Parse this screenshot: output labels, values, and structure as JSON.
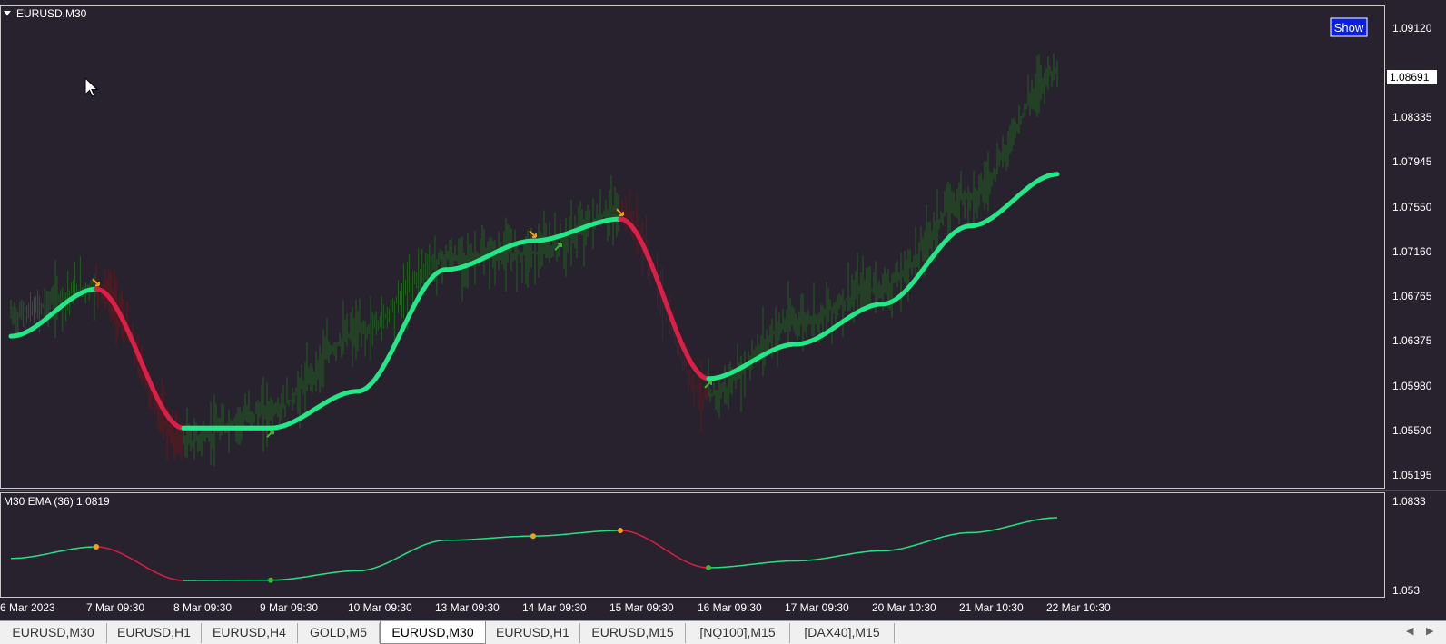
{
  "symbol_label": "EURUSD,M30",
  "show_button": "Show",
  "current_price": "1.08691",
  "price_axis_labels": [
    "1.09120",
    "1.08335",
    "1.07945",
    "1.07550",
    "1.07160",
    "1.06765",
    "1.06375",
    "1.05980",
    "1.05590",
    "1.05195"
  ],
  "indicator": {
    "label": "M30 EMA (36) 1.0819",
    "axis_labels": [
      "1.0833",
      "1.053"
    ]
  },
  "time_axis_labels": [
    "6 Mar 2023",
    "7 Mar 09:30",
    "8 Mar 09:30",
    "9 Mar 09:30",
    "10 Mar 09:30",
    "13 Mar 09:30",
    "14 Mar 09:30",
    "15 Mar 09:30",
    "16 Mar 09:30",
    "17 Mar 09:30",
    "20 Mar 10:30",
    "21 Mar 10:30",
    "22 Mar 10:30"
  ],
  "tabs": [
    {
      "label": "EURUSD,M30",
      "active": false
    },
    {
      "label": "EURUSD,H1",
      "active": false
    },
    {
      "label": "EURUSD,H4",
      "active": false
    },
    {
      "label": "GOLD,M5",
      "active": false
    },
    {
      "label": "EURUSD,M30",
      "active": true
    },
    {
      "label": "EURUSD,H1",
      "active": false
    },
    {
      "label": "EURUSD,M15",
      "active": false
    },
    {
      "label": "[NQ100],M15",
      "active": false
    },
    {
      "label": "[DAX40],M15",
      "active": false
    }
  ],
  "colors": {
    "background": "#28222f",
    "bullish": "#23e887",
    "bearish": "#dc1f47",
    "price_up": "#1f5e1f",
    "price_down": "#6b1414",
    "signal_up_arrow": "#3fb535",
    "signal_down_arrow": "#f0a020",
    "axis_text": "#ffffff",
    "show_button_bg": "#0a1ee6"
  },
  "chart_data": [
    {
      "type": "line",
      "title": "EURUSD,M30",
      "x": [
        "6 Mar 2023",
        "7 Mar 09:30",
        "8 Mar 09:30",
        "9 Mar 09:30",
        "10 Mar 09:30",
        "13 Mar 09:30",
        "14 Mar 09:30",
        "15 Mar 09:30",
        "16 Mar 09:30",
        "17 Mar 09:30",
        "20 Mar 10:30",
        "21 Mar 10:30",
        "22 Mar 10:30"
      ],
      "ylim": [
        1.0505,
        1.0925
      ],
      "series": [
        {
          "values": [
            1.0637,
            1.0678,
            1.0557,
            1.0557,
            1.0589,
            1.0695,
            1.072,
            1.0739,
            1.06,
            1.063,
            1.0665,
            1.0733,
            1.0778
          ]
        },
        {
          "values": [
            1.0655,
            1.068,
            1.0545,
            1.0572,
            1.064,
            1.0705,
            1.071,
            1.0745,
            1.0585,
            1.065,
            1.068,
            1.076,
            1.0869
          ]
        }
      ],
      "signals": [
        {
          "x": "7 Mar 09:30",
          "direction": "down"
        },
        {
          "x": "9 Mar 09:30",
          "direction": "up"
        },
        {
          "x": "14 Mar 09:30",
          "direction": "down"
        },
        {
          "x": "14 Mar 09:30",
          "direction": "up"
        },
        {
          "x": "15 Mar 09:30",
          "direction": "down"
        },
        {
          "x": "16 Mar 09:30",
          "direction": "up"
        }
      ]
    },
    {
      "type": "line",
      "title": "M30 EMA (36) 1.0819",
      "ylim": [
        1.05,
        1.087
      ],
      "series": [
        {
          "values": [
            1.0636,
            1.0677,
            1.0558,
            1.0559,
            1.0592,
            1.07,
            1.0715,
            1.0735,
            1.0603,
            1.0627,
            1.0663,
            1.0727,
            1.078
          ]
        }
      ]
    }
  ]
}
